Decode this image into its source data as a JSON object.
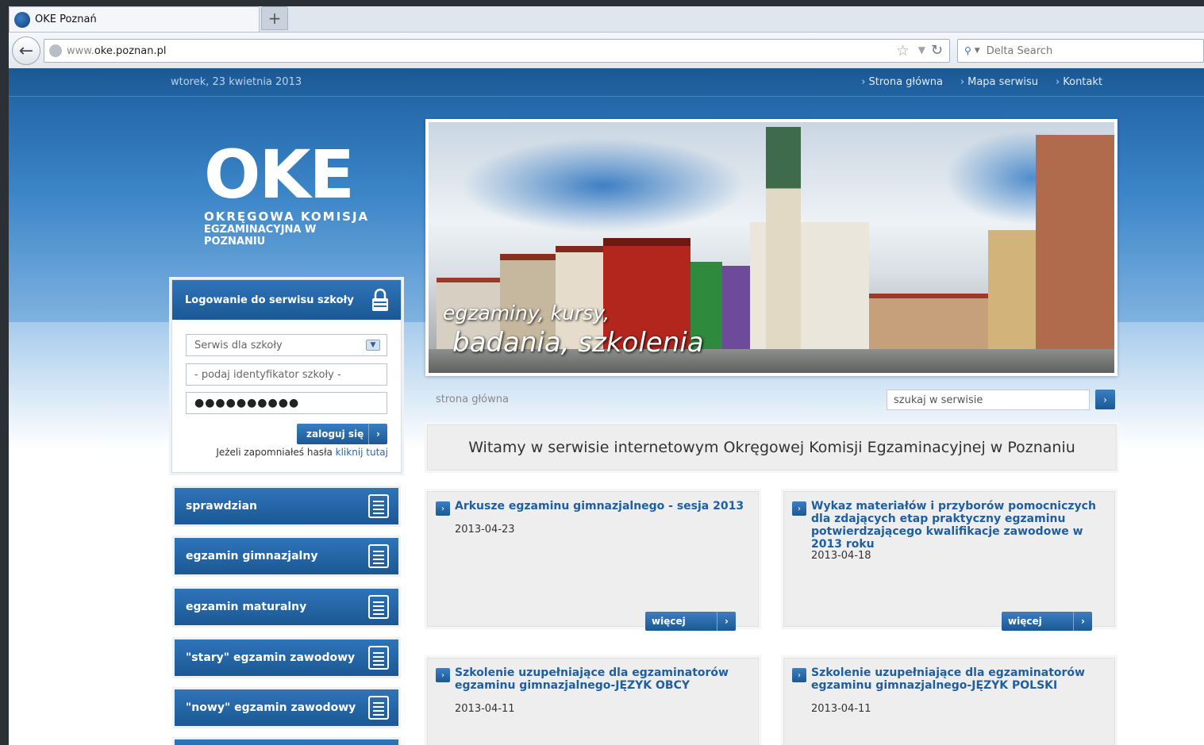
{
  "browser": {
    "tab_title": "OKE Poznań",
    "new_tab": "+",
    "url_prefix": "www.",
    "url_main": "oke.poznan.pl",
    "search_placeholder": "Delta Search"
  },
  "topbar": {
    "date": "wtorek, 23 kwietnia 2013",
    "links": [
      "Strona główna",
      "Mapa serwisu",
      "Kontakt"
    ]
  },
  "logo": {
    "mark": "OKE",
    "line1": "OKRĘGOWA KOMISJA",
    "line2": "EGZAMINACYJNA W POZNANIU"
  },
  "login": {
    "title": "Logowanie do serwisu szkoły",
    "select_value": "Serwis dla szkoły",
    "identifier_placeholder": "- podaj identyfikator szkoły -",
    "password_mask": "●●●●●●●●●●",
    "button": "zaloguj się",
    "forgot_text": "Jeżeli zapomniałeś hasła ",
    "forgot_link": "kliknij tutaj"
  },
  "menu": [
    "sprawdzian",
    "egzamin gimnazjalny",
    "egzamin maturalny",
    "\"stary\" egzamin zawodowy",
    "\"nowy\" egzamin zawodowy"
  ],
  "banner": {
    "caption1": "egzaminy, kursy,",
    "caption2": "badania, szkolenia"
  },
  "breadcrumb": "strona główna",
  "site_search": {
    "placeholder": "szukaj w serwisie"
  },
  "welcome": "Witamy w serwisie internetowym Okręgowej Komisji Egzaminacyjnej w Poznaniu",
  "news": [
    {
      "title": "Arkusze egzaminu gimnazjalnego - sesja 2013",
      "date": "2013-04-23",
      "more": "więcej"
    },
    {
      "title": "Wykaz materiałów i przyborów pomocniczych dla zdających etap praktyczny egzaminu potwierdzającego kwalifikacje zawodowe w 2013 roku",
      "date": "2013-04-18",
      "more": "więcej"
    },
    {
      "title": "Szkolenie uzupełniające dla egzaminatorów egzaminu gimnazjalnego-JĘZYK OBCY",
      "date": "2013-04-11"
    },
    {
      "title": "Szkolenie uzupełniające dla egzaminatorów egzaminu gimnazjalnego-JĘZYK POLSKI",
      "date": "2013-04-11"
    }
  ]
}
